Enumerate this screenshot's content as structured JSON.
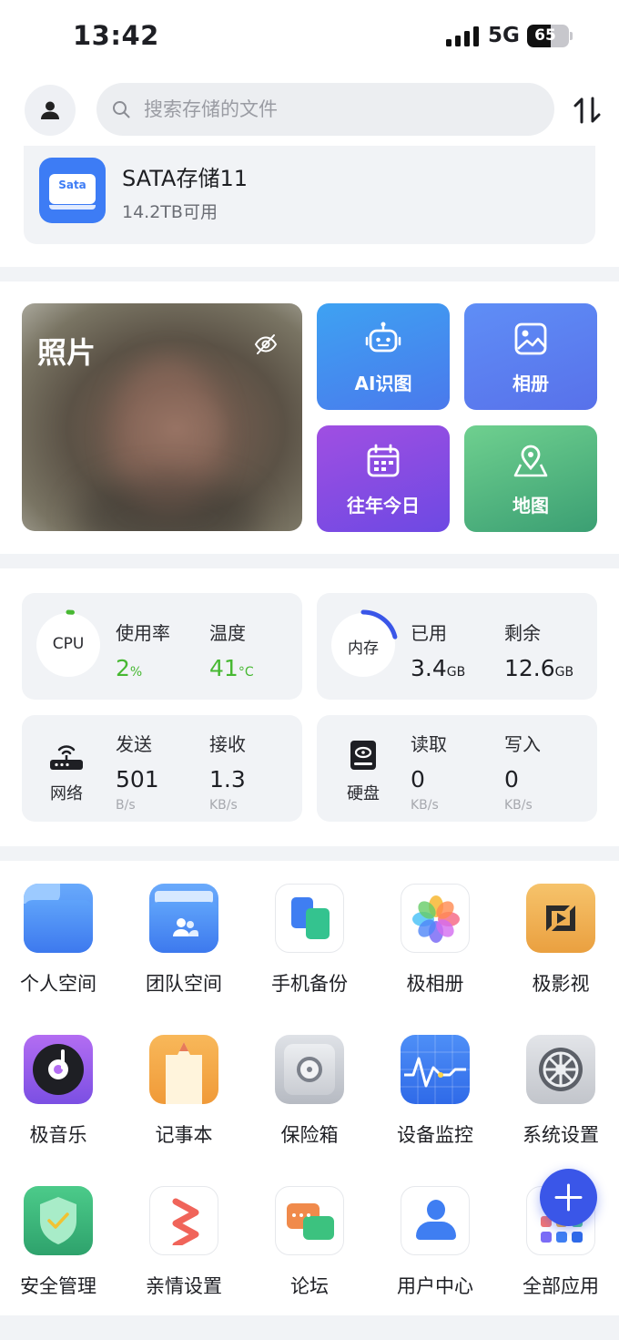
{
  "status_bar": {
    "time": "13:42",
    "network": "5G",
    "battery": "65",
    "battery_level": 0.65
  },
  "search": {
    "placeholder": "搜索存储的文件"
  },
  "storage": {
    "badge": "Sata",
    "name": "SATA存储11",
    "available": "14.2TB可用"
  },
  "photos": {
    "title": "照片",
    "tiles": [
      {
        "label": "AI识图",
        "icon": "robot-icon"
      },
      {
        "label": "相册",
        "icon": "image-icon"
      },
      {
        "label": "往年今日",
        "icon": "calendar-icon"
      },
      {
        "label": "地图",
        "icon": "map-pin-icon"
      }
    ]
  },
  "monitor": {
    "cpu": {
      "label": "CPU",
      "usage_label": "使用率",
      "usage_value": "2",
      "usage_unit": "%",
      "usage_fraction": 0.02,
      "temp_label": "温度",
      "temp_value": "41",
      "temp_unit": "°C"
    },
    "memory": {
      "label": "内存",
      "used_label": "已用",
      "used_value": "3.4",
      "used_unit": "GB",
      "free_label": "剩余",
      "free_value": "12.6",
      "free_unit": "GB",
      "used_fraction": 0.21
    },
    "network": {
      "label": "网络",
      "send_label": "发送",
      "send_value": "501",
      "send_unit": "B/s",
      "recv_label": "接收",
      "recv_value": "1.3",
      "recv_unit": "KB/s"
    },
    "disk": {
      "label": "硬盘",
      "read_label": "读取",
      "read_value": "0",
      "read_unit": "KB/s",
      "write_label": "写入",
      "write_value": "0",
      "write_unit": "KB/s"
    }
  },
  "apps": [
    {
      "name": "个人空间",
      "icon": "folder-icon"
    },
    {
      "name": "团队空间",
      "icon": "team-folder-icon"
    },
    {
      "name": "手机备份",
      "icon": "phone-backup-icon"
    },
    {
      "name": "极相册",
      "icon": "flower-icon"
    },
    {
      "name": "极影视",
      "icon": "video-icon"
    },
    {
      "name": "极音乐",
      "icon": "music-icon"
    },
    {
      "name": "记事本",
      "icon": "notepad-icon"
    },
    {
      "name": "保险箱",
      "icon": "safe-icon"
    },
    {
      "name": "设备监控",
      "icon": "monitor-chart-icon"
    },
    {
      "name": "系统设置",
      "icon": "settings-gear-icon"
    },
    {
      "name": "安全管理",
      "icon": "shield-icon"
    },
    {
      "name": "亲情设置",
      "icon": "family-icon"
    },
    {
      "name": "论坛",
      "icon": "chat-icon"
    },
    {
      "name": "用户中心",
      "icon": "user-icon"
    },
    {
      "name": "全部应用",
      "icon": "grid-apps-icon"
    }
  ],
  "colors": {
    "accent": "#3a56e8",
    "green": "#47b832",
    "card_bg": "#f1f3f6"
  }
}
